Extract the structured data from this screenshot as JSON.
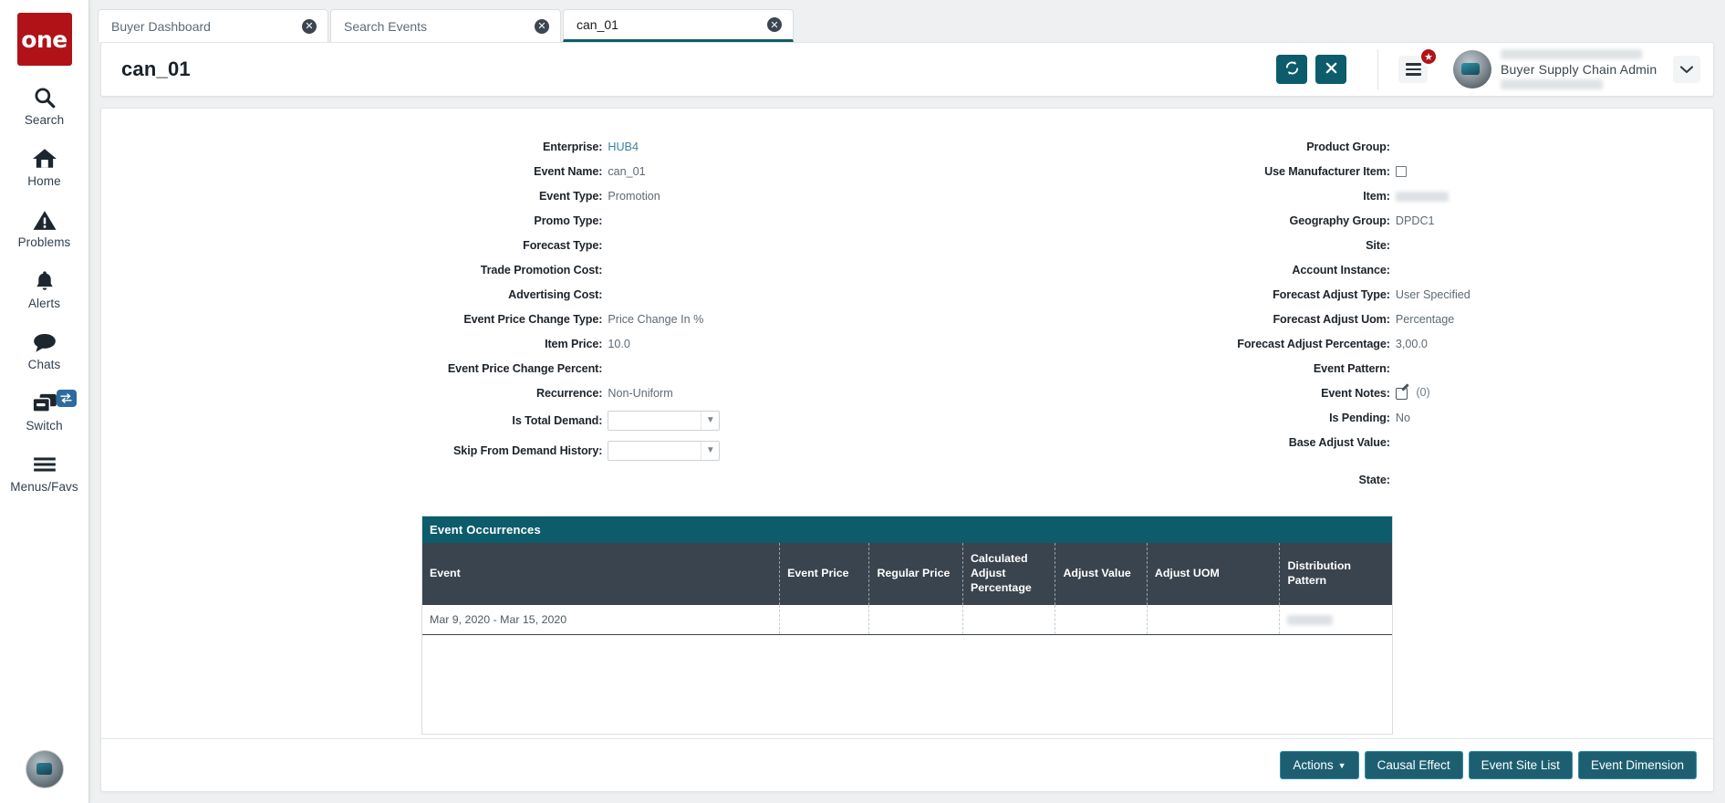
{
  "sidebar": {
    "logo_text": "one",
    "items": [
      {
        "label": "Search",
        "icon": "search-icon"
      },
      {
        "label": "Home",
        "icon": "home-icon"
      },
      {
        "label": "Problems",
        "icon": "warning-triangle-icon"
      },
      {
        "label": "Alerts",
        "icon": "bell-icon"
      },
      {
        "label": "Chats",
        "icon": "chat-bubble-icon"
      },
      {
        "label": "Switch",
        "icon": "switch-windows-icon",
        "badge_icon": "swap-arrows-icon"
      },
      {
        "label": "Menus/Favs",
        "icon": "hamburger-icon"
      }
    ]
  },
  "tabs": [
    {
      "label": "Buyer Dashboard",
      "close": "✕",
      "active": false
    },
    {
      "label": "Search Events",
      "close": "✕",
      "active": false
    },
    {
      "label": "can_01",
      "close": "✕",
      "active": true
    }
  ],
  "header": {
    "title": "can_01",
    "refresh_icon": "refresh-icon",
    "close_icon": "close-icon",
    "menu_icon": "hamburger-icon",
    "star_badge": "★",
    "user_role": "Buyer Supply Chain Admin",
    "caret": "❯"
  },
  "form": {
    "left": [
      {
        "label": "Enterprise:",
        "value": "HUB4",
        "style": "link"
      },
      {
        "label": "Event Name:",
        "value": "can_01",
        "style": "dark"
      },
      {
        "label": "Event Type:",
        "value": "Promotion",
        "style": "dark"
      },
      {
        "label": "Promo Type:",
        "value": "",
        "style": "dark"
      },
      {
        "label": "Forecast Type:",
        "value": "",
        "style": "dark"
      },
      {
        "label": "Trade Promotion Cost:",
        "value": "",
        "style": "dark"
      },
      {
        "label": "Advertising Cost:",
        "value": "",
        "style": "dark"
      },
      {
        "label": "Event Price Change Type:",
        "value": "Price Change In %",
        "style": "dark"
      },
      {
        "label": "Item Price:",
        "value": "10.0",
        "style": "dark"
      },
      {
        "label": "Event Price Change Percent:",
        "value": "",
        "style": "dark"
      },
      {
        "label": "Recurrence:",
        "value": "Non-Uniform",
        "style": "dark"
      },
      {
        "label": "Is Total Demand:",
        "value": "",
        "style": "select"
      },
      {
        "label": "Skip From Demand History:",
        "value": "",
        "style": "select"
      }
    ],
    "right": [
      {
        "label": "Product Group:",
        "value": "",
        "style": "dark"
      },
      {
        "label": "Use Manufacturer Item:",
        "value": "",
        "style": "checkbox"
      },
      {
        "label": "Item:",
        "value": "",
        "style": "redacted"
      },
      {
        "label": "Geography Group:",
        "value": "DPDC1",
        "style": "dark"
      },
      {
        "label": "Site:",
        "value": "",
        "style": "dark"
      },
      {
        "label": "Account Instance:",
        "value": "",
        "style": "dark"
      },
      {
        "label": "Forecast Adjust Type:",
        "value": "User Specified",
        "style": "dark"
      },
      {
        "label": "Forecast Adjust Uom:",
        "value": "Percentage",
        "style": "dark"
      },
      {
        "label": "Forecast Adjust Percentage:",
        "value": "3,00.0",
        "style": "dark"
      },
      {
        "label": "Event Pattern:",
        "value": "",
        "style": "dark"
      },
      {
        "label": "Event Notes:",
        "value": "(0)",
        "style": "note"
      },
      {
        "label": "Is Pending:",
        "value": "No",
        "style": "dark"
      },
      {
        "label": "Base Adjust Value:",
        "value": "",
        "style": "dark"
      },
      {
        "label": "State:",
        "value": "",
        "style": "dark"
      }
    ]
  },
  "table": {
    "title": "Event Occurrences",
    "columns": [
      "Event",
      "Event Price",
      "Regular Price",
      "Calculated Adjust Percentage",
      "Adjust Value",
      "Adjust UOM",
      "Distribution Pattern"
    ],
    "rows": [
      {
        "event": "Mar 9, 2020 - Mar 15, 2020",
        "event_price": "",
        "regular_price": "",
        "calculated_adjust_percentage": "",
        "adjust_value": "",
        "adjust_uom": "",
        "distribution_pattern": ""
      }
    ]
  },
  "footer": {
    "buttons": [
      {
        "label": "Actions",
        "has_caret": true
      },
      {
        "label": "Causal Effect",
        "has_caret": false
      },
      {
        "label": "Event Site List",
        "has_caret": false
      },
      {
        "label": "Event Dimension",
        "has_caret": false
      }
    ]
  },
  "colors": {
    "brand_red": "#b01217",
    "teal": "#0d5c6b",
    "table_header": "#3a444e",
    "button": "#1d5f70"
  }
}
